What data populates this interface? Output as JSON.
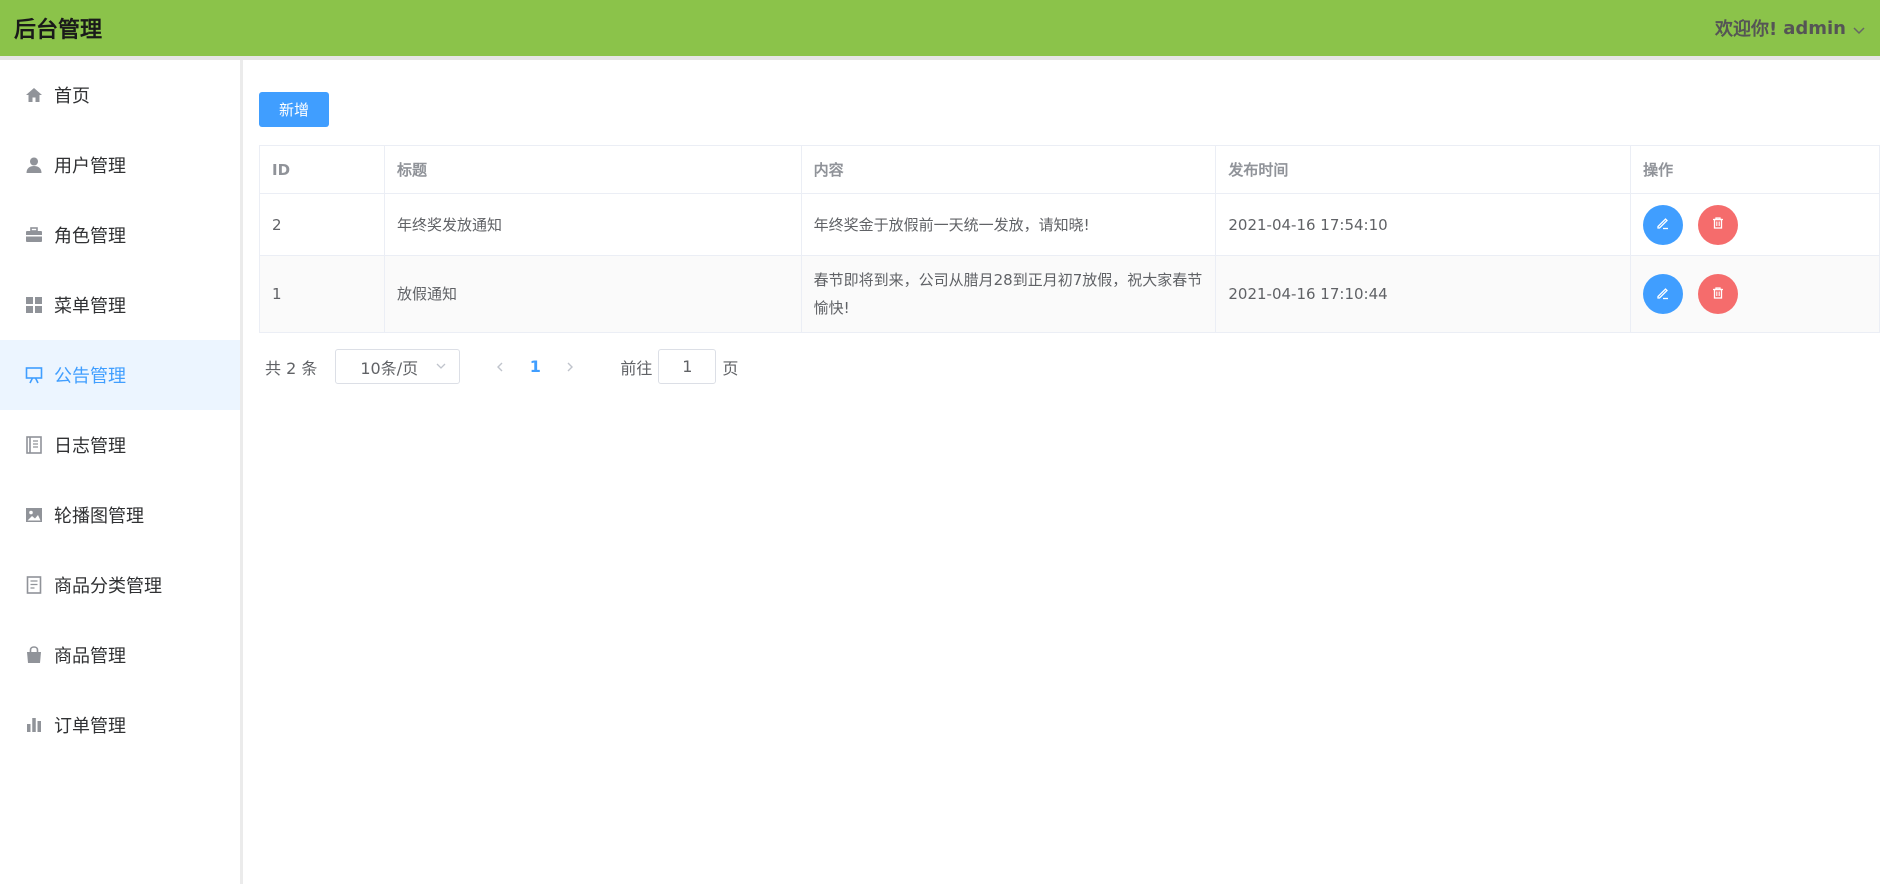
{
  "header": {
    "title": "后台管理",
    "welcome": "欢迎你!",
    "username": "admin"
  },
  "sidebar": {
    "items": [
      {
        "label": "首页",
        "icon": "home-icon"
      },
      {
        "label": "用户管理",
        "icon": "user-icon"
      },
      {
        "label": "角色管理",
        "icon": "briefcase-icon"
      },
      {
        "label": "菜单管理",
        "icon": "grid-icon"
      },
      {
        "label": "公告管理",
        "icon": "presentation-icon",
        "active": true
      },
      {
        "label": "日志管理",
        "icon": "notebook-icon"
      },
      {
        "label": "轮播图管理",
        "icon": "picture-icon"
      },
      {
        "label": "商品分类管理",
        "icon": "document-icon"
      },
      {
        "label": "商品管理",
        "icon": "shopping-bag-icon"
      },
      {
        "label": "订单管理",
        "icon": "bar-chart-icon"
      }
    ]
  },
  "toolbar": {
    "add_label": "新增"
  },
  "table": {
    "columns": [
      "ID",
      "标题",
      "内容",
      "发布时间",
      "操作"
    ],
    "rows": [
      {
        "id": "2",
        "title": "年终奖发放通知",
        "content": "年终奖金于放假前一天统一发放，请知晓!",
        "time": "2021-04-16 17:54:10"
      },
      {
        "id": "1",
        "title": "放假通知",
        "content": "春节即将到来，公司从腊月28到正月初7放假，祝大家春节愉快!",
        "time": "2021-04-16 17:10:44"
      }
    ]
  },
  "pagination": {
    "total_label": "共 2 条",
    "page_size": "10条/页",
    "current_page": "1",
    "goto_prefix": "前往",
    "goto_value": "1",
    "goto_suffix": "页"
  },
  "colors": {
    "header_bg": "#8bc34a",
    "primary": "#409eff",
    "danger": "#f56c6c",
    "active_bg": "#ecf5ff"
  }
}
